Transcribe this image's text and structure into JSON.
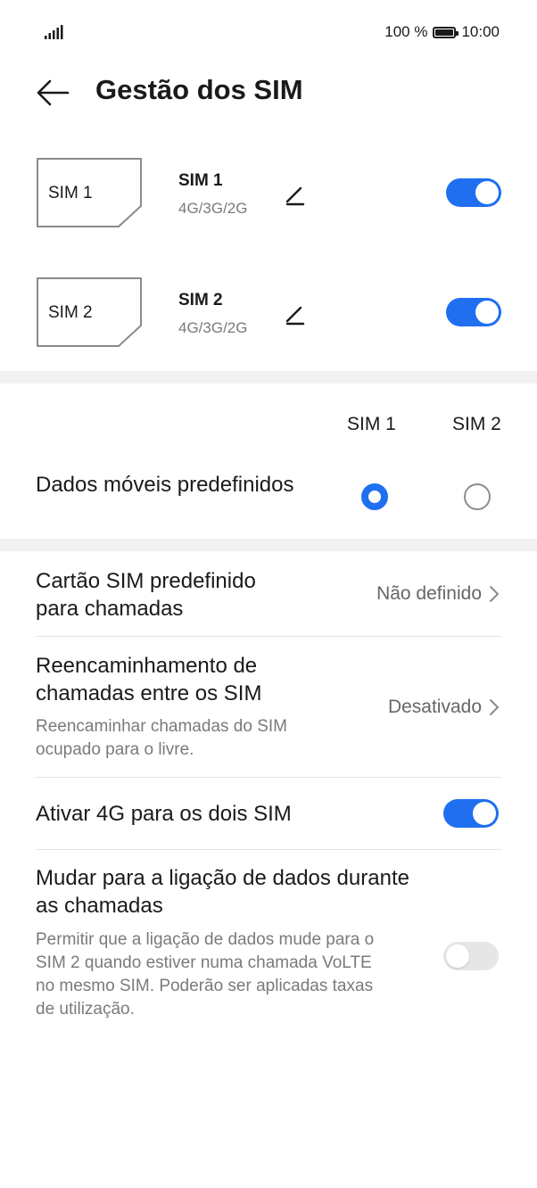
{
  "status_bar": {
    "battery_text": "100 %",
    "battery_level": 100,
    "time": "10:00",
    "signal_icon": "signal-bars-icon"
  },
  "header": {
    "back_icon": "back-arrow-icon",
    "title": "Gestão dos SIM"
  },
  "sims": [
    {
      "card_label": "SIM 1",
      "name": "SIM 1",
      "network": "4G/3G/2G",
      "enabled": true
    },
    {
      "card_label": "SIM 2",
      "name": "SIM 2",
      "network": "4G/3G/2G",
      "enabled": true
    }
  ],
  "columns": {
    "sim1": "SIM 1",
    "sim2": "SIM 2"
  },
  "mobile_data": {
    "title": "Dados móveis predefinidos",
    "selected": "SIM 1"
  },
  "settings": {
    "default_call_sim": {
      "title": "Cartão SIM predefinido para chamadas",
      "value": "Não definido"
    },
    "call_forwarding": {
      "title": "Reencaminhamento de chamadas entre os SIM",
      "subtitle": "Reencaminhar chamadas do SIM ocupado para o livre.",
      "value": "Desativado"
    },
    "enable_4g": {
      "title": "Ativar 4G para os dois SIM",
      "enabled": true
    },
    "data_switch": {
      "title": "Mudar para a ligação de dados durante as chamadas",
      "subtitle": "Permitir que a ligação de dados mude para o SIM 2 quando estiver numa chamada VoLTE no mesmo SIM. Poderão ser aplicadas taxas de utilização.",
      "enabled": false
    }
  },
  "colors": {
    "accent": "#1f6ff0",
    "toggle_off": "#e6e6e6",
    "secondary_text": "#7a7a7a"
  }
}
